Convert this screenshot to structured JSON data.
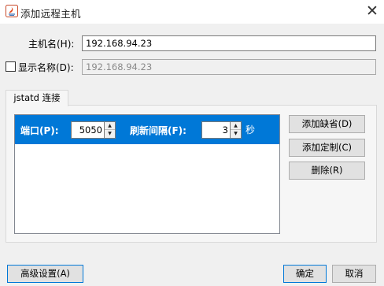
{
  "window": {
    "title": "添加远程主机",
    "close_glyph": "✕",
    "icon_name": "java-app-icon"
  },
  "form": {
    "host_label": "主机名(H):",
    "host_value": "192.168.94.23",
    "display_label": "显示名称(D):",
    "display_value": "192.168.94.23",
    "display_checked": false
  },
  "tab": {
    "label": "jstatd 连接"
  },
  "connection": {
    "port_label": "端口(P):",
    "port_value": "5050",
    "refresh_label": "刷新间隔(F):",
    "refresh_value": "3",
    "unit_label": "秒"
  },
  "side_buttons": {
    "add_default": "添加缺省(D)",
    "add_custom": "添加定制(C)",
    "delete": "删除(R)"
  },
  "footer": {
    "advanced": "高级设置(A)",
    "ok": "确定",
    "cancel": "取消"
  },
  "colors": {
    "selection": "#0078d7",
    "focus_border": "#0078d7",
    "window_bg": "#f0f0f0"
  }
}
